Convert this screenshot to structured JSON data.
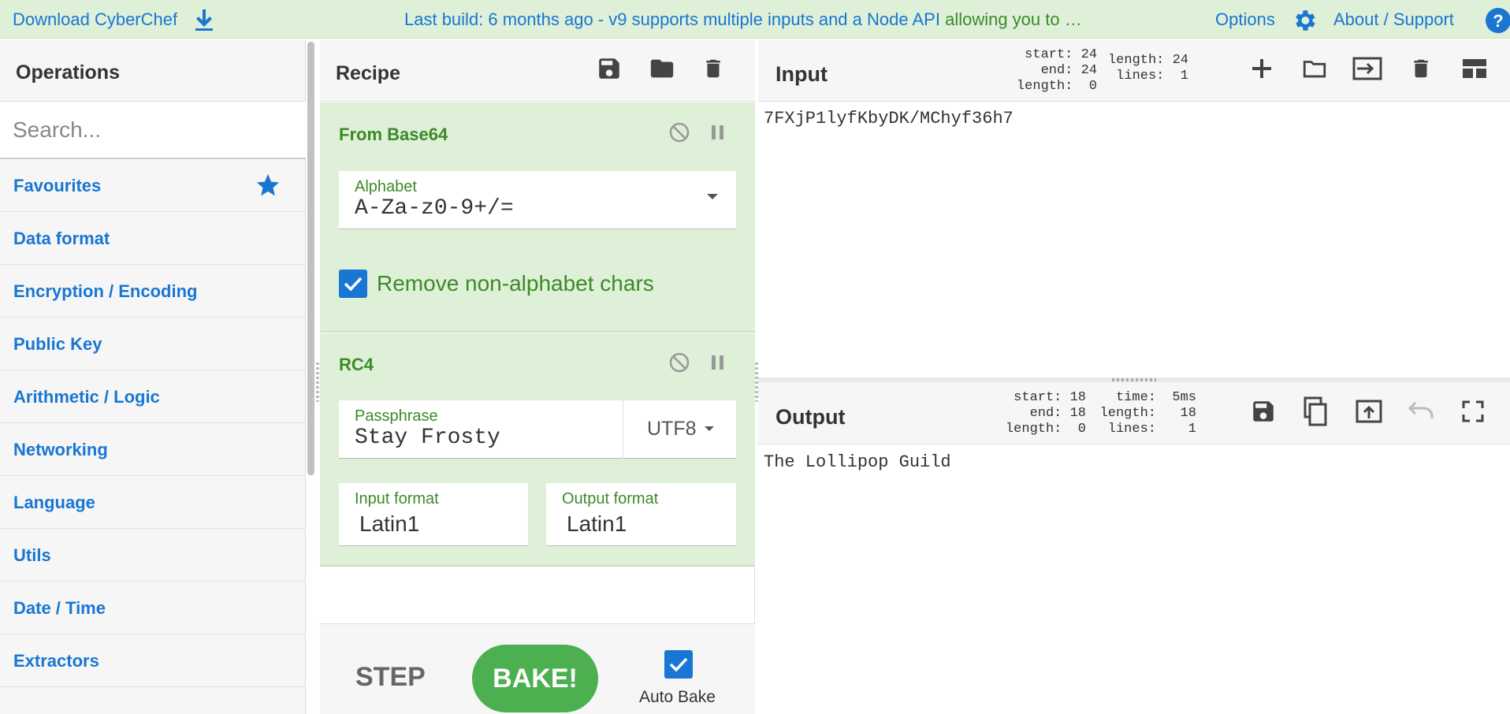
{
  "banner": {
    "download_label": "Download CyberChef",
    "message_blue": "Last build: 6 months ago - v9 supports multiple inputs and a Node API ",
    "message_green": "allowing you to …",
    "options_label": "Options",
    "about_label": "About / Support"
  },
  "operations": {
    "title": "Operations",
    "search_placeholder": "Search...",
    "categories": [
      {
        "label": "Favourites"
      },
      {
        "label": "Data format"
      },
      {
        "label": "Encryption / Encoding"
      },
      {
        "label": "Public Key"
      },
      {
        "label": "Arithmetic / Logic"
      },
      {
        "label": "Networking"
      },
      {
        "label": "Language"
      },
      {
        "label": "Utils"
      },
      {
        "label": "Date / Time"
      },
      {
        "label": "Extractors"
      }
    ]
  },
  "recipe": {
    "title": "Recipe",
    "ops": [
      {
        "name": "From Base64",
        "alphabet_label": "Alphabet",
        "alphabet_value": "A-Za-z0-9+/=",
        "remove_label": "Remove non-alphabet chars",
        "remove_checked": true
      },
      {
        "name": "RC4",
        "passphrase_label": "Passphrase",
        "passphrase_value": "Stay Frosty",
        "passphrase_encoding": "UTF8",
        "input_format_label": "Input format",
        "input_format_value": "Latin1",
        "output_format_label": "Output format",
        "output_format_value": "Latin1"
      }
    ],
    "step_label": "STEP",
    "bake_label": "BAKE!",
    "auto_bake_label": "Auto Bake",
    "auto_bake_checked": true
  },
  "input": {
    "title": "Input",
    "stats_sel": "start: 24\n  end: 24\nlength:  0",
    "stats_len": "length: 24\n lines:  1",
    "text": "7FXjP1lyfKbyDK/MChyf36h7"
  },
  "output": {
    "title": "Output",
    "stats_sel": "start: 18\n  end: 18\nlength:  0",
    "stats_len": "time:  5ms\nlength:   18\n lines:    1",
    "text": "The Lollipop Guild"
  },
  "colors": {
    "accent": "#1976d2",
    "op_bg": "#dff0d8",
    "op_text": "#3c8a28",
    "bake": "#4caf50"
  }
}
